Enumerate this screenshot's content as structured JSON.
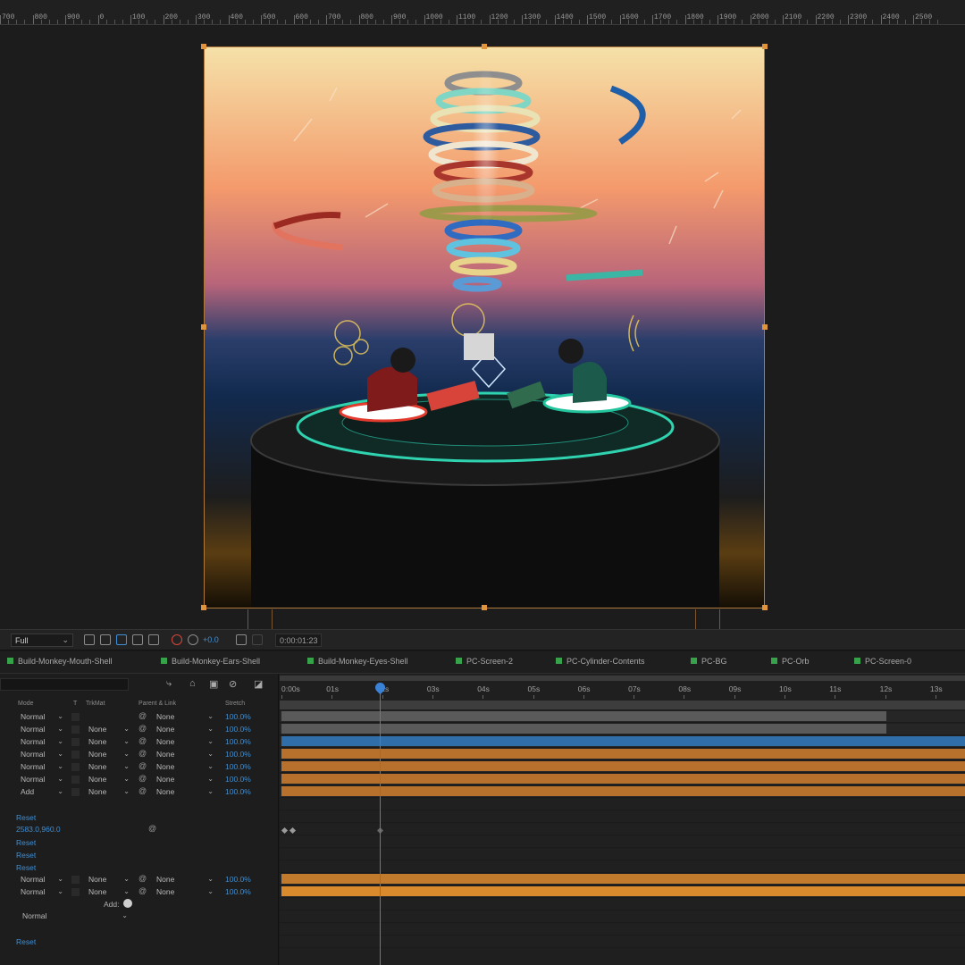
{
  "ruler": {
    "labels": [
      "700",
      "800",
      "900",
      "0",
      "100",
      "200",
      "300",
      "400",
      "500",
      "600",
      "700",
      "800",
      "900",
      "1000",
      "1100",
      "1200",
      "1300",
      "1400",
      "1500",
      "1600",
      "1700",
      "1800",
      "1900",
      "2000",
      "2100",
      "2200",
      "2300",
      "2400",
      "2500"
    ]
  },
  "viewer_bar": {
    "resolution": "Full",
    "exposure": "+0.0",
    "timecode": "0:00:01:23"
  },
  "comp_tabs": [
    "Build-Monkey-Mouth-Shell",
    "Build-Monkey-Ears-Shell",
    "Build-Monkey-Eyes-Shell",
    "PC-Screen-2",
    "PC-Cylinder-Contents",
    "PC-BG",
    "PC-Orb",
    "PC-Screen-0"
  ],
  "columns": {
    "mode": "Mode",
    "t": "T",
    "trkmat": "TrkMat",
    "parent": "Parent & Link",
    "stretch": "Stretch"
  },
  "layers": [
    {
      "mode": "Normal",
      "trkmat": "",
      "parent": "None",
      "stretch": "100.0%"
    },
    {
      "mode": "Normal",
      "trkmat": "None",
      "parent": "None",
      "stretch": "100.0%"
    },
    {
      "mode": "Normal",
      "trkmat": "None",
      "parent": "None",
      "stretch": "100.0%"
    },
    {
      "mode": "Normal",
      "trkmat": "None",
      "parent": "None",
      "stretch": "100.0%"
    },
    {
      "mode": "Normal",
      "trkmat": "None",
      "parent": "None",
      "stretch": "100.0%"
    },
    {
      "mode": "Normal",
      "trkmat": "None",
      "parent": "None",
      "stretch": "100.0%"
    },
    {
      "mode": "Add",
      "trkmat": "None",
      "parent": "None",
      "stretch": "100.0%"
    }
  ],
  "props": {
    "reset1": "Reset",
    "position": "2583.0,960.0",
    "reset2": "Reset",
    "reset3": "Reset",
    "reset4": "Reset"
  },
  "layers2": [
    {
      "mode": "Normal",
      "trkmat": "None",
      "parent": "None",
      "stretch": "100.0%"
    },
    {
      "mode": "Normal",
      "trkmat": "None",
      "parent": "None",
      "stretch": "100.0%"
    }
  ],
  "add_label": "Add:",
  "blend_mode": "Normal",
  "reset_last": "Reset",
  "timeline": {
    "labels": [
      "0:00s",
      "01s",
      "02s",
      "03s",
      "04s",
      "05s",
      "06s",
      "07s",
      "08s",
      "09s",
      "10s",
      "11s",
      "12s",
      "13s"
    ],
    "current_time_seconds": 1.96
  },
  "tracks": [
    {
      "color": "#5a5a5a",
      "end": 0.885
    },
    {
      "color": "#5a5a5a",
      "end": 0.885
    },
    {
      "color": "#2f6ea8",
      "end": 1.0
    },
    {
      "color": "#b8712d",
      "end": 1.0
    },
    {
      "color": "#b8712d",
      "end": 1.0
    },
    {
      "color": "#b8712d",
      "end": 1.0
    },
    {
      "color": "#b8712d",
      "end": 1.0
    }
  ],
  "tracks2": [
    {
      "color": "#c27a2c",
      "end": 1.0
    },
    {
      "color": "#d98a2c",
      "end": 1.0
    }
  ]
}
